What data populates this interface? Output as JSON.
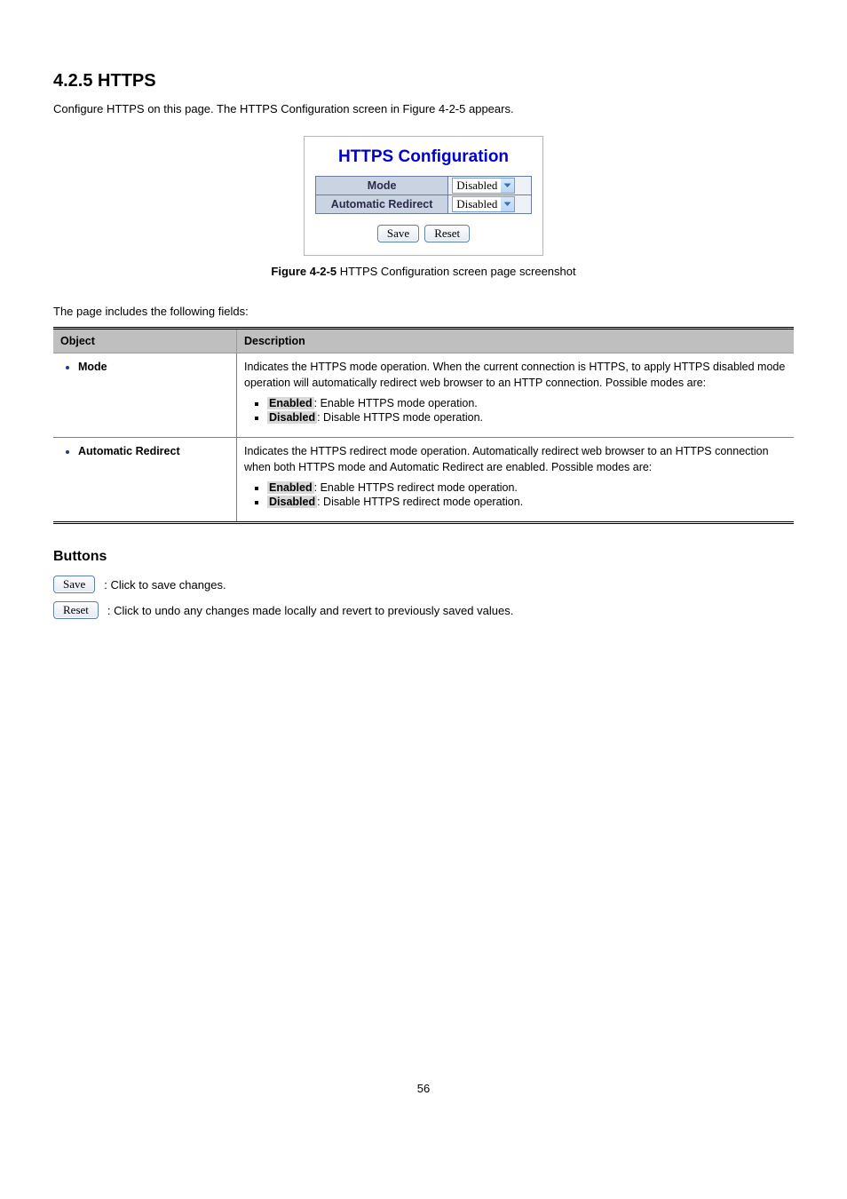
{
  "section": {
    "number": "4.2.5",
    "title": "HTTPS"
  },
  "intro": "Configure HTTPS on this page. The HTTPS Configuration screen in Figure 4-2-5 appears.",
  "panel": {
    "title": "HTTPS Configuration",
    "rows": [
      {
        "label": "Mode",
        "value": "Disabled"
      },
      {
        "label": "Automatic Redirect",
        "value": "Disabled"
      }
    ],
    "save": "Save",
    "reset": "Reset"
  },
  "figure": {
    "label_bold": "Figure 4-2-5",
    "label_rest": " HTTPS Configuration screen page screenshot"
  },
  "table_intro": "The page includes the following fields:",
  "table": {
    "head_object": "Object",
    "head_desc": "Description",
    "rows": [
      {
        "object": "Mode",
        "lead": "Indicates the HTTPS mode operation. When the current connection is HTTPS, to apply HTTPS disabled mode operation will automatically redirect web browser to an HTTP connection. Possible modes are:",
        "items": [
          {
            "key": "Enabled",
            "rest": ": Enable HTTPS mode operation."
          },
          {
            "key": "Disabled",
            "rest": ": Disable HTTPS mode operation."
          }
        ]
      },
      {
        "object": "Automatic Redirect",
        "lead": "Indicates the HTTPS redirect mode operation. Automatically redirect web browser to an HTTPS connection when both HTTPS mode and Automatic Redirect are enabled. Possible modes are:",
        "items": [
          {
            "key": "Enabled",
            "rest": ": Enable HTTPS redirect mode operation."
          },
          {
            "key": "Disabled",
            "rest": ": Disable HTTPS redirect mode operation."
          }
        ]
      }
    ]
  },
  "buttons": {
    "heading": "Buttons",
    "save_label": "Save",
    "save_desc": ": Click to save changes.",
    "reset_label": "Reset",
    "reset_desc": ": Click to undo any changes made locally and revert to previously saved values."
  },
  "page_number": "56"
}
